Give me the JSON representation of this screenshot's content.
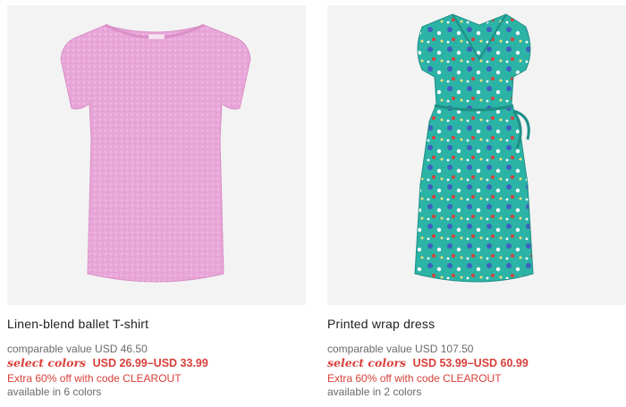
{
  "products": [
    {
      "name": "Linen-blend ballet T-shirt",
      "comparable": "comparable value USD 46.50",
      "select_label": "select colors",
      "price": "USD 26.99–USD 33.99",
      "promo": "Extra 60% off with code CLEAROUT",
      "availability": "available in 6 colors",
      "colors": {
        "garment": "#e9a6d8",
        "garment_shade": "#d98fc7"
      }
    },
    {
      "name": "Printed wrap dress",
      "comparable": "comparable value USD 107.50",
      "select_label": "select colors",
      "price": "USD 53.99–USD 60.99",
      "promo": "Extra 60% off with code CLEAROUT",
      "availability": "available in 2 colors",
      "colors": {
        "garment": "#2bb3a6",
        "garment_shade": "#1e8f86"
      }
    }
  ],
  "colors": {
    "price_red": "#d8413a",
    "muted_text": "#6a6a6a",
    "image_bg": "#f3f3f3"
  }
}
